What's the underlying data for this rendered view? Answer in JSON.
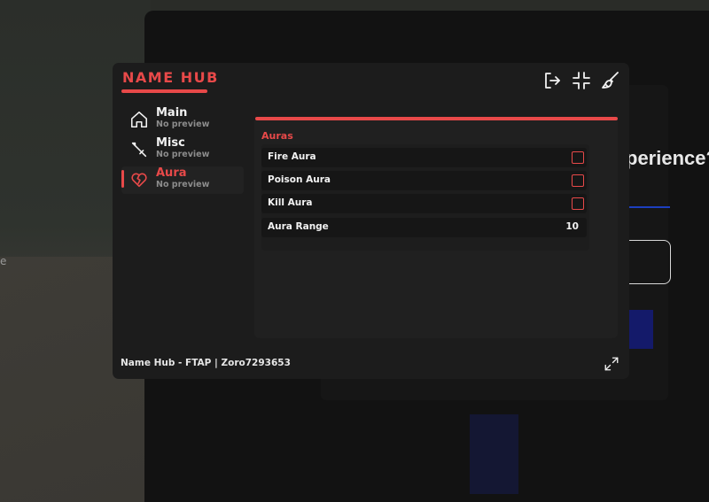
{
  "background": {
    "question_text": "perience?",
    "edge_text": "e"
  },
  "hub": {
    "title": "NAME HUB",
    "accent_color": "#e84949",
    "top_icons": [
      "exit-icon",
      "minimize-icon",
      "paintbrush-icon"
    ],
    "sidebar": {
      "items": [
        {
          "label": "Main",
          "subtitle": "No preview",
          "icon": "home-icon",
          "active": false
        },
        {
          "label": "Misc",
          "subtitle": "No preview",
          "icon": "sword-icon",
          "active": false
        },
        {
          "label": "Aura",
          "subtitle": "No preview",
          "icon": "broken-heart-icon",
          "active": true
        }
      ]
    },
    "section": {
      "title": "Auras",
      "rows": [
        {
          "label": "Fire Aura",
          "type": "checkbox",
          "checked": false
        },
        {
          "label": "Poison Aura",
          "type": "checkbox",
          "checked": false
        },
        {
          "label": "Kill Aura",
          "type": "checkbox",
          "checked": false
        },
        {
          "label": "Aura Range",
          "type": "value",
          "value": "10"
        }
      ]
    },
    "footer": "Name Hub - FTAP | Zoro7293653",
    "footer_icon": "expand-icon"
  }
}
